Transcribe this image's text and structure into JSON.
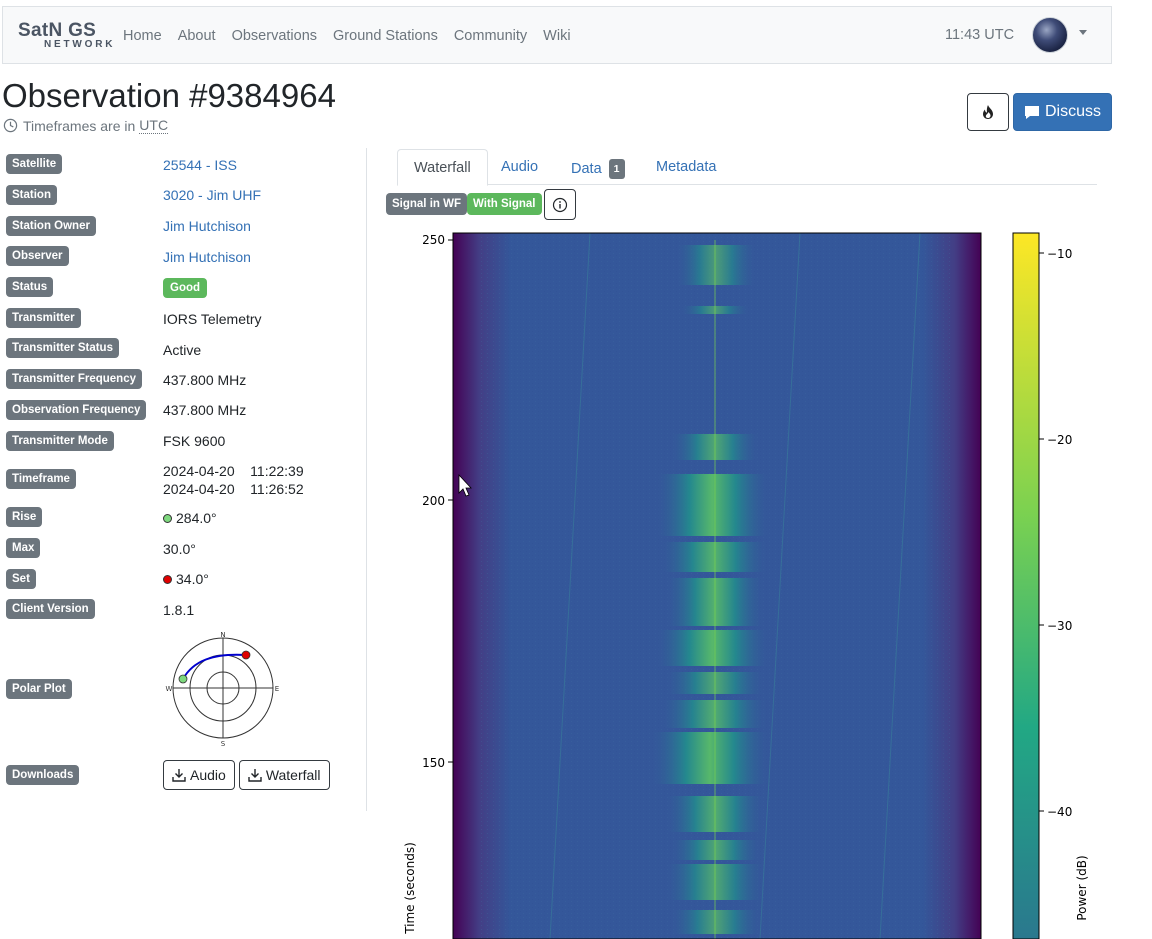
{
  "navbar": {
    "brand_top": "SatN GS",
    "brand_bottom": "NETWORK",
    "links": [
      "Home",
      "About",
      "Observations",
      "Ground Stations",
      "Community",
      "Wiki"
    ],
    "time": "11:43 UTC"
  },
  "header": {
    "title": "Observation #9384964",
    "tz_note": "Timeframes are in",
    "tz_abbr": "UTC",
    "discuss_label": "Discuss"
  },
  "details": {
    "satellite_label": "Satellite",
    "satellite_value": "25544 - ISS",
    "station_label": "Station",
    "station_value": "3020 - Jim UHF",
    "owner_label": "Station Owner",
    "owner_value": "Jim Hutchison",
    "observer_label": "Observer",
    "observer_value": "Jim Hutchison",
    "status_label": "Status",
    "status_value": "Good",
    "transmitter_label": "Transmitter",
    "transmitter_value": "IORS Telemetry",
    "tx_status_label": "Transmitter Status",
    "tx_status_value": "Active",
    "tx_freq_label": "Transmitter Frequency",
    "tx_freq_value": "437.800 MHz",
    "obs_freq_label": "Observation Frequency",
    "obs_freq_value": "437.800 MHz",
    "tx_mode_label": "Transmitter Mode",
    "tx_mode_value": "FSK 9600",
    "timeframe_label": "Timeframe",
    "timeframe_start": "2024-04-20    11:22:39",
    "timeframe_end": "2024-04-20    11:26:52",
    "rise_label": "Rise",
    "rise_value": "284.0°",
    "max_label": "Max",
    "max_value": "30.0°",
    "set_label": "Set",
    "set_value": "34.0°",
    "client_label": "Client Version",
    "client_value": "1.8.1",
    "polar_label": "Polar Plot",
    "downloads_label": "Downloads",
    "download_audio": "Audio",
    "download_waterfall": "Waterfall"
  },
  "polar": {
    "n": "N",
    "e": "E",
    "s": "S",
    "w": "W"
  },
  "tabs": {
    "waterfall": "Waterfall",
    "audio": "Audio",
    "data": "Data",
    "data_count": "1",
    "metadata": "Metadata"
  },
  "signal": {
    "signal_in_wf": "Signal in WF",
    "with_signal": "With Signal"
  },
  "waterfall": {
    "ylabel": "Time (seconds)",
    "y_ticks": [
      "250",
      "200",
      "150"
    ],
    "colorbar_label": "Power (dB)",
    "colorbar_ticks": [
      "−10",
      "−20",
      "−30",
      "−40"
    ]
  },
  "colors": {
    "link": "#3471b5",
    "label_bg": "#6c757d",
    "good": "#5cb85c",
    "rise_dot": "#7ed87e",
    "set_dot": "#e00000",
    "polar_track": "#0000cc",
    "waterfall_bg": "#34579a",
    "waterfall_edge": "#440154"
  },
  "icons": [
    "clock-icon",
    "fire-icon",
    "comment-icon",
    "download-icon",
    "info-icon",
    "caret-down-icon",
    "mouse-cursor"
  ]
}
